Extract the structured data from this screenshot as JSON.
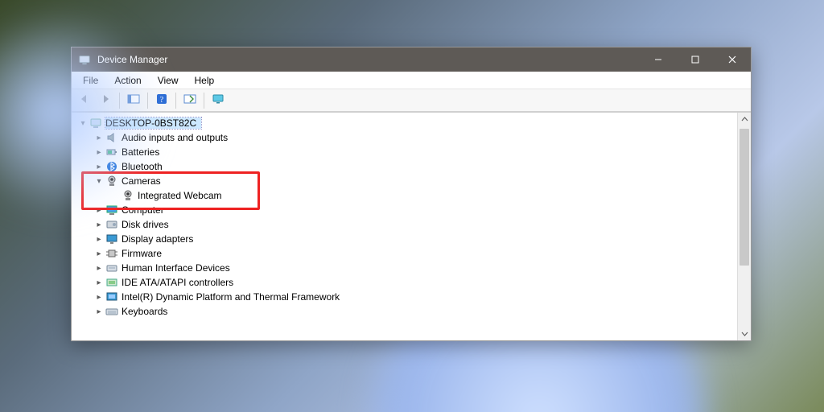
{
  "window": {
    "title": "Device Manager"
  },
  "menus": {
    "file": "File",
    "action": "Action",
    "view": "View",
    "help": "Help"
  },
  "tree": {
    "root": "DESKTOP-0BST82C",
    "items": [
      {
        "label": "Audio inputs and outputs"
      },
      {
        "label": "Batteries"
      },
      {
        "label": "Bluetooth"
      },
      {
        "label": "Cameras",
        "expanded": true,
        "children": [
          {
            "label": "Integrated Webcam"
          }
        ]
      },
      {
        "label": "Computer"
      },
      {
        "label": "Disk drives"
      },
      {
        "label": "Display adapters"
      },
      {
        "label": "Firmware"
      },
      {
        "label": "Human Interface Devices"
      },
      {
        "label": "IDE ATA/ATAPI controllers"
      },
      {
        "label": "Intel(R) Dynamic Platform and Thermal Framework"
      },
      {
        "label": "Keyboards"
      }
    ]
  },
  "icons": {
    "back": "back-icon",
    "forward": "forward-icon"
  }
}
